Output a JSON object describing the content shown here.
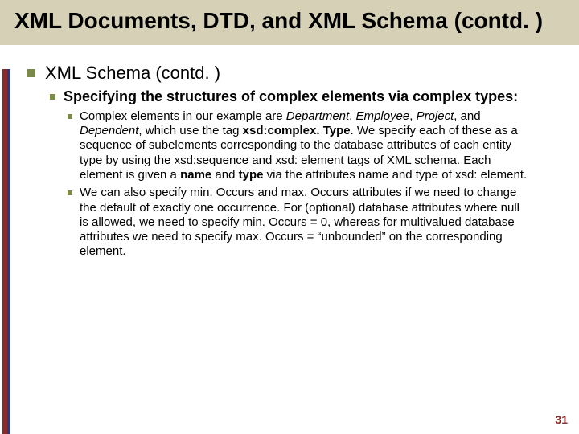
{
  "title": "XML Documents, DTD, and XML Schema (contd. )",
  "lvl1": "XML Schema (contd. )",
  "lvl2": "Specifying the structures of complex elements via complex types:",
  "para1": {
    "lead": "Complex elements in our example are ",
    "d": "Department",
    "sep1": ", ",
    "e": "Employee",
    "sep2": ", ",
    "p": "Project",
    "sep3": ", and ",
    "dep": "Dependent",
    "mid1": ", which use the tag ",
    "tag1": "xsd:complex. Type",
    "mid2": ". We specify each of these as a sequence of subelements corresponding to the database attributes of each entity type by using the xsd:sequence and xsd: element tags of XML schema. Each element is given a ",
    "name": "name",
    "mid3": " and ",
    "type": "type",
    "tail": " via the attributes name and type of xsd: element."
  },
  "para2": "We can also specify min. Occurs and max. Occurs attributes if we need to change the default of exactly one occurrence. For (optional) database attributes where null is allowed, we need to specify min. Occurs = 0, whereas for multivalued database attributes we need to specify max. Occurs = “unbounded” on the corresponding element.",
  "pagenum": "31"
}
